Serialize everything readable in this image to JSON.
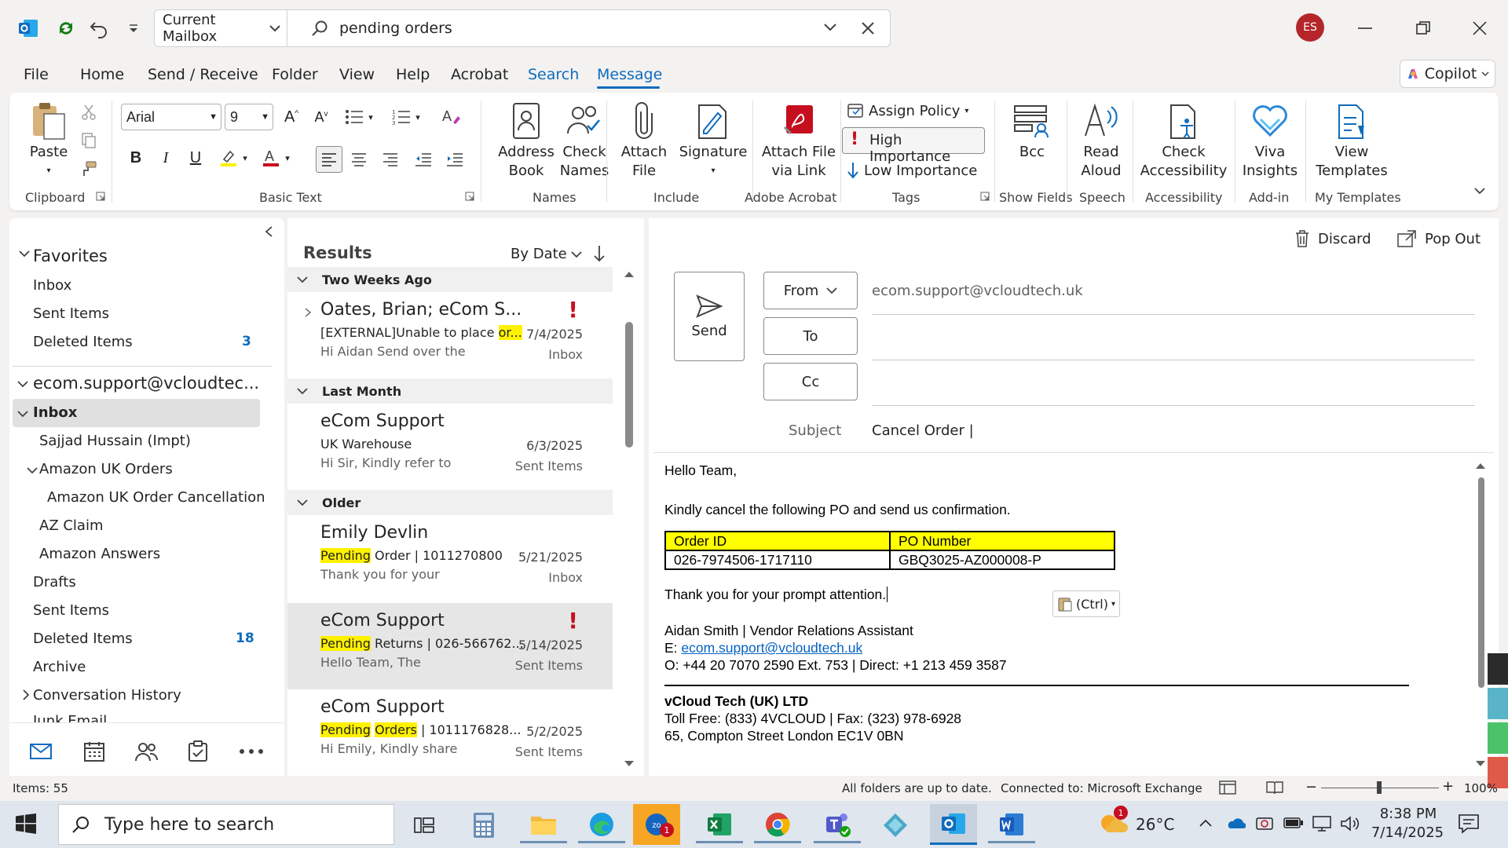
{
  "titlebar": {
    "search_scope": "Current Mailbox",
    "search_query": "pending orders",
    "avatar_initials": "ES"
  },
  "menu": {
    "tabs": [
      "File",
      "Home",
      "Send / Receive",
      "Folder",
      "View",
      "Help",
      "Acrobat",
      "Search",
      "Message"
    ],
    "copilot_label": "Copilot"
  },
  "ribbon": {
    "paste": "Paste",
    "font_name": "Arial",
    "font_size": "9",
    "address_book": [
      "Address",
      "Book"
    ],
    "check_names": [
      "Check",
      "Names"
    ],
    "attach_file": [
      "Attach",
      "File"
    ],
    "signature": "Signature",
    "attach_via_link": [
      "Attach File",
      "via Link"
    ],
    "assign_policy": "Assign Policy",
    "high_importance": "High Importance",
    "low_importance": "Low Importance",
    "bcc": "Bcc",
    "read_aloud": [
      "Read",
      "Aloud"
    ],
    "check_accessibility": [
      "Check",
      "Accessibility"
    ],
    "viva_insights": [
      "Viva",
      "Insights"
    ],
    "view_templates": [
      "View",
      "Templates"
    ],
    "groups": {
      "clipboard": "Clipboard",
      "basic_text": "Basic Text",
      "names": "Names",
      "include": "Include",
      "adobe": "Adobe Acrobat",
      "tags": "Tags",
      "show_fields": "Show Fields",
      "speech": "Speech",
      "accessibility": "Accessibility",
      "addin": "Add-in",
      "templates": "My Templates"
    }
  },
  "folders": {
    "favorites_header": "Favorites",
    "favorites": [
      {
        "label": "Inbox",
        "count": ""
      },
      {
        "label": "Sent Items",
        "count": ""
      },
      {
        "label": "Deleted Items",
        "count": "3"
      }
    ],
    "account": "ecom.support@vcloudtec...",
    "inbox": "Inbox",
    "sub": {
      "sajjad": "Sajjad Hussain (Impt)",
      "amazon_uk": "Amazon UK Orders",
      "amazon_cancel": "Amazon UK Order Cancellation",
      "az_claim": "AZ Claim",
      "amazon_answers": "Amazon Answers",
      "drafts": "Drafts",
      "sent": "Sent Items",
      "deleted": "Deleted Items",
      "deleted_count": "18",
      "archive": "Archive",
      "conversation": "Conversation History",
      "junk": "Junk Email"
    }
  },
  "results": {
    "header": "Results",
    "sort": "By Date",
    "groups": {
      "g1": "Two Weeks Ago",
      "g2": "Last Month",
      "g3": "Older"
    },
    "items": [
      {
        "sender": "Oates, Brian;  eCom S...",
        "subject_pre": "[EXTERNAL]Unable to place ",
        "subject_hl": "or...",
        "preview": "Hi Aidan  Send over the",
        "date": "7/4/2025",
        "folder": "Inbox",
        "importance": "!"
      },
      {
        "sender": "eCom Support",
        "subject": "UK Warehouse",
        "preview": "Hi Sir,  Kindly refer to",
        "date": "6/3/2025",
        "folder": "Sent Items"
      },
      {
        "sender": "Emily Devlin",
        "subject_hl": "Pending",
        "subject_post": " Order | 1011270800",
        "preview": "Thank you for your",
        "date": "5/21/2025",
        "folder": "Inbox"
      },
      {
        "sender": "eCom Support",
        "subject_hl": "Pending",
        "subject_post": " Returns | 026-566762...",
        "preview": "Hello Team,  The",
        "date": "5/14/2025",
        "folder": "Sent Items",
        "importance": "!"
      },
      {
        "sender": "eCom Support",
        "subject_hl": "Pending",
        "subject_hl2": "Orders",
        "subject_post": " |  1011176828...",
        "preview": "Hi Emily,  Kindly share",
        "date": "5/2/2025",
        "folder": "Sent Items"
      }
    ]
  },
  "compose": {
    "discard": "Discard",
    "popout": "Pop Out",
    "send": "Send",
    "from_label": "From",
    "from_value": "ecom.support@vcloudtech.uk",
    "to_label": "To",
    "cc_label": "Cc",
    "subject_label": "Subject",
    "subject_value": "Cancel Order |",
    "body": {
      "greeting": "Hello Team,",
      "line1": "Kindly cancel the following PO and send us confirmation.",
      "table_headers": [
        "Order ID",
        "PO Number"
      ],
      "table_row": [
        "026-7974506-1717110",
        "GBQ3025-AZ000008-P"
      ],
      "thanks": "Thank you for your prompt attention.",
      "sig_name": "Aidan Smith | Vendor Relations Assistant",
      "sig_email_label": "E: ",
      "sig_email": "ecom.support@vcloudtech.uk",
      "sig_phone": "O:  +44 20 7070 2590 Ext. 753 | Direct: +1 213 459 3587",
      "company": "vCloud Tech (UK) LTD",
      "tollfree": "Toll Free: (833) 4VCLOUD | Fax: (323) 978-6928",
      "address": "65, Compton Street London EC1V 0BN"
    },
    "ctrl_label": "(Ctrl)"
  },
  "status": {
    "items": "Items: 55",
    "uptodate": "All folders are up to date.",
    "connected": "Connected to: Microsoft Exchange",
    "zoom": "100%"
  },
  "taskbar": {
    "search_placeholder": "Type here to search",
    "weather": "26°C",
    "time": "8:38 PM",
    "date": "7/14/2025",
    "weather_badge": "1",
    "zoho_badge": "1"
  }
}
